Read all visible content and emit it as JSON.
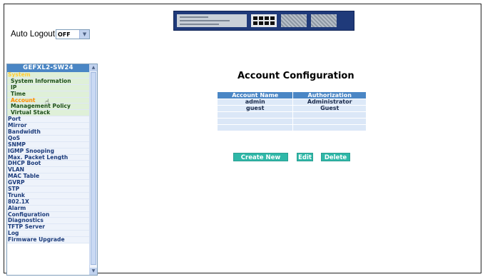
{
  "auto_logout": {
    "label": "Auto Logout",
    "selected": "OFF"
  },
  "sidebar": {
    "header": "GEFXL2-SW24",
    "items": [
      {
        "label": "System",
        "type": "group"
      },
      {
        "label": "System Information",
        "type": "sub"
      },
      {
        "label": "IP",
        "type": "sub"
      },
      {
        "label": "Time",
        "type": "sub"
      },
      {
        "label": "Account",
        "type": "sub",
        "active": true
      },
      {
        "label": "Management Policy",
        "type": "sub"
      },
      {
        "label": "Virtual Stack",
        "type": "sub"
      },
      {
        "label": "Port",
        "type": "item"
      },
      {
        "label": "Mirror",
        "type": "item"
      },
      {
        "label": "Bandwidth",
        "type": "item"
      },
      {
        "label": "QoS",
        "type": "item"
      },
      {
        "label": "SNMP",
        "type": "item"
      },
      {
        "label": "IGMP Snooping",
        "type": "item"
      },
      {
        "label": "Max. Packet Length",
        "type": "item"
      },
      {
        "label": "DHCP Boot",
        "type": "item"
      },
      {
        "label": "VLAN",
        "type": "item"
      },
      {
        "label": "MAC Table",
        "type": "item"
      },
      {
        "label": "GVRP",
        "type": "item"
      },
      {
        "label": "STP",
        "type": "item"
      },
      {
        "label": "Trunk",
        "type": "item"
      },
      {
        "label": "802.1X",
        "type": "item"
      },
      {
        "label": "Alarm",
        "type": "item"
      },
      {
        "label": "Configuration",
        "type": "item"
      },
      {
        "label": "Diagnostics",
        "type": "item"
      },
      {
        "label": "TFTP Server",
        "type": "item"
      },
      {
        "label": "Log",
        "type": "item"
      },
      {
        "label": "Firmware Upgrade",
        "type": "item"
      }
    ]
  },
  "main": {
    "title": "Account Configuration",
    "table": {
      "headers": [
        "Account Name",
        "Authorization"
      ],
      "rows": [
        [
          "admin",
          "Administrator"
        ],
        [
          "guest",
          "Guest"
        ]
      ],
      "empty_rows": 3
    },
    "buttons": {
      "create": "Create New",
      "edit": "Edit",
      "delete": "Delete"
    }
  }
}
